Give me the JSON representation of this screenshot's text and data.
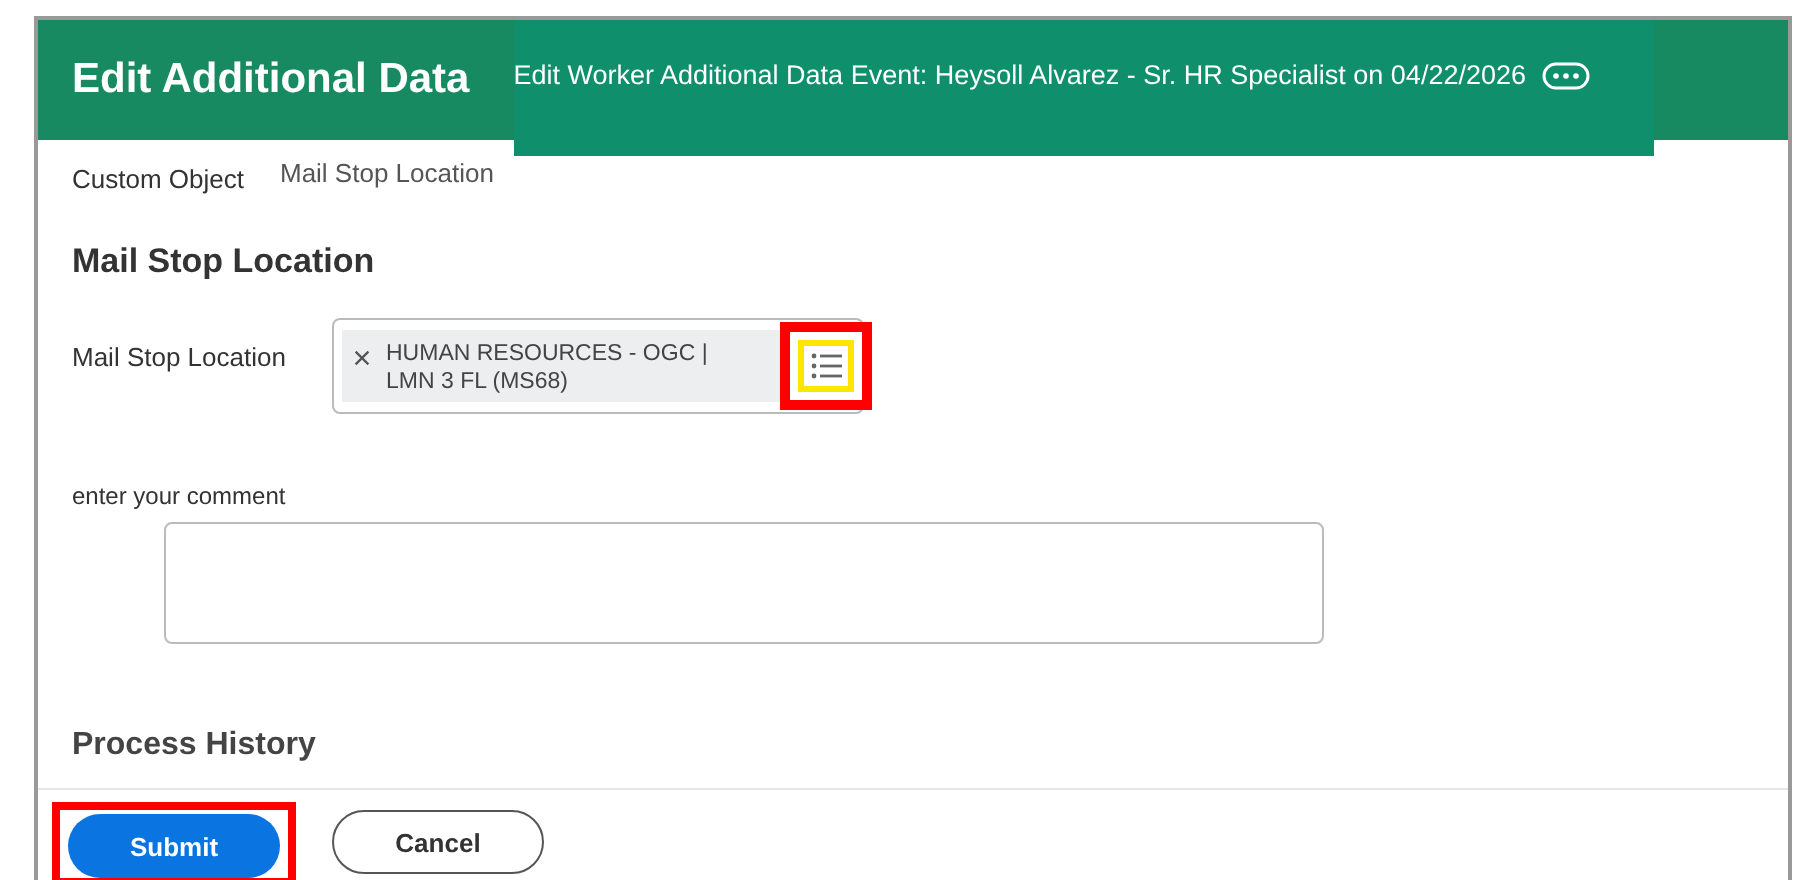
{
  "header": {
    "title": "Edit Additional Data",
    "subtitle": "Edit Worker Additional Data Event: Heysoll Alvarez - Sr. HR Specialist on 04/22/2026"
  },
  "breadcrumb": {
    "label": "Custom Object",
    "value": "Mail Stop Location"
  },
  "section": {
    "title": "Mail Stop Location"
  },
  "field": {
    "label": "Mail Stop Location",
    "value": "HUMAN RESOURCES - OGC | LMN 3 FL (MS68)",
    "prompt_highlighted": true
  },
  "comment": {
    "label": "enter your comment"
  },
  "process_history": {
    "title": "Process History"
  },
  "buttons": [
    {
      "label": "Submit",
      "kind": "primary",
      "highlighted": true
    },
    {
      "label": "Cancel",
      "kind": "secondary",
      "highlighted": false
    }
  ]
}
